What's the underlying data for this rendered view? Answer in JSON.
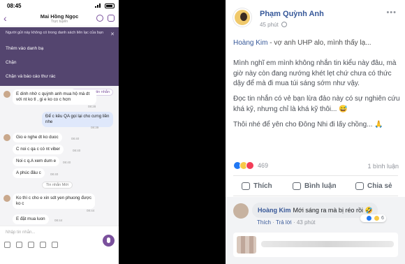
{
  "phone": {
    "status_time": "08:45",
    "contact_name": "Mai Hồng Ngọc",
    "contact_status": "Trực tuyến",
    "spam_notice": "Người gửi này không có trong danh sách liên lạc của bạn",
    "spam_options": [
      "Thêm vào danh bạ",
      "Chặn",
      "Chặn và báo cáo thư rác"
    ],
    "seen_label": "Bạn đã xem tin nhắn",
    "messages": [
      {
        "dir": "in",
        "text": "E dinh nhờ c quỳnh anh mua hộ mà dt với nt ko tl , gi e ko co c hcm",
        "time": "08:28"
      },
      {
        "dir": "out",
        "text": "Để c kêu QA gọi lại cho cưng liền nhe",
        "time": "08:39"
      },
      {
        "dir": "in",
        "text": "Gio e nghe dt ko duoc",
        "time": "08:40"
      },
      {
        "dir": "in",
        "text": "C noi c qa c có nt viber",
        "time": "08:40"
      },
      {
        "dir": "in",
        "text": "Noi c q.A xem dum e",
        "time": "08:40"
      },
      {
        "dir": "in",
        "text": "A phúc đâu c",
        "time": "08:40"
      },
      {
        "dir": "in",
        "text": "Ko thì c cho e xin sdt yen phuong được ko c",
        "time": "08:44"
      },
      {
        "dir": "in",
        "text": "E đặt mua luon",
        "time": "08:44"
      }
    ],
    "new_messages_label": "Tin nhắn Mới",
    "composer_placeholder": "Nhập tin nhắn...",
    "composer_icons": [
      "sticker-icon",
      "emoji-icon",
      "gallery-icon",
      "camera-icon",
      "gif-icon"
    ]
  },
  "post": {
    "author": "Phạm Quỳnh Anh",
    "time": "45 phút",
    "tag_line_name": "Hoàng Kim",
    "tag_line_text": " - vợ anh UHP alo, mình thấy lạ...",
    "paragraphs": [
      "Mình nghĩ em mình không nhắn tin kiểu này đâu, mà giờ này còn đang nướng khét lẹt chứ chưa có thức dậy để mà đi mua túi sáng sớm như vậy.",
      "Đọc tin nhắn có vẻ bạn lừa đảo này có sự nghiên cứu khá kỹ, nhưng chỉ là khá kỹ thôi... 😅",
      "Thôi nhé để yên cho Đông Nhi đi lấy chồng... 🙏"
    ],
    "reaction_count": "469",
    "share_count": "1 bình luận",
    "actions": [
      "Thích",
      "Bình luận",
      "Chia sẻ"
    ],
    "comment": {
      "author": "Hoàng Kim",
      "text": "Mới sáng ra mà bị réo rồi 🤣",
      "reactions": "6",
      "like_label": "Thích",
      "reply_label": "Trả lời",
      "time": "43 phút"
    }
  }
}
